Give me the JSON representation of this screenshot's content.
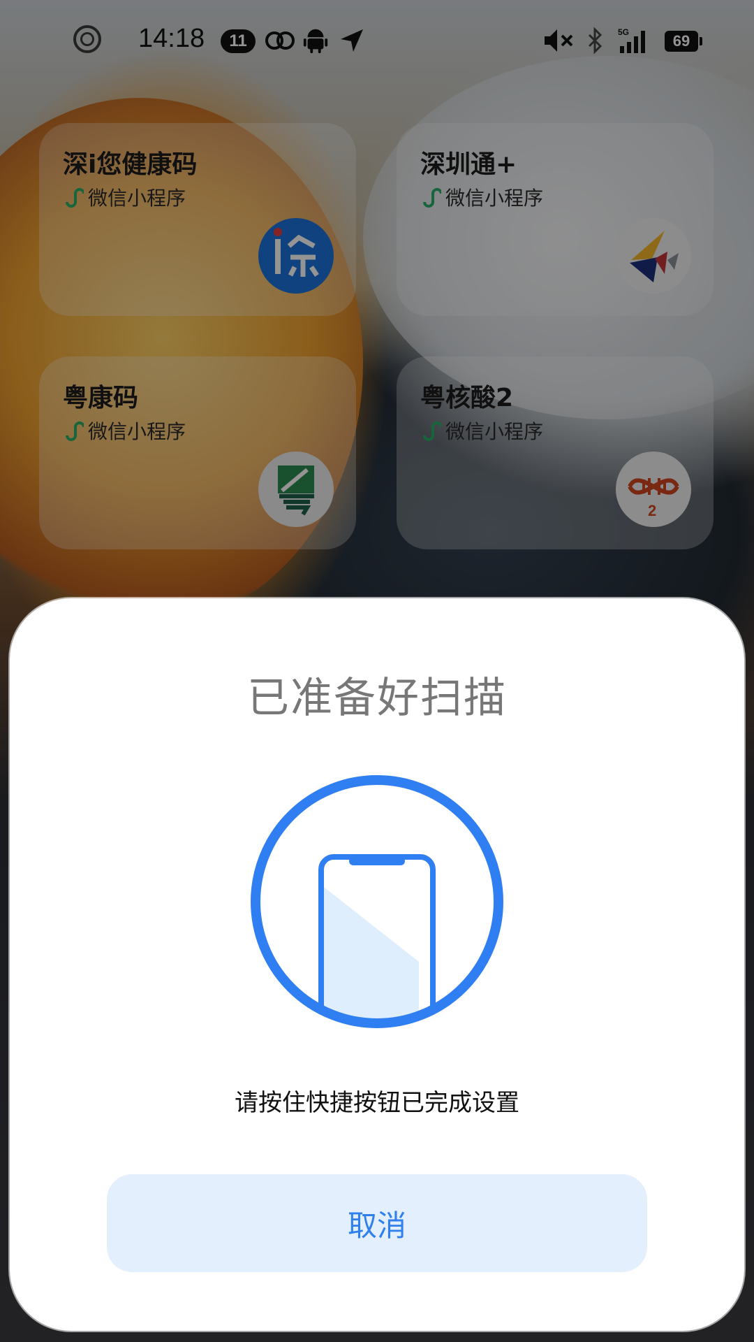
{
  "status_bar": {
    "time": "14:18",
    "notification_count": "11",
    "battery": "69",
    "network": "5G",
    "icons": [
      "circle-status-icon",
      "infinity-icon",
      "android-icon",
      "location-arrow-icon",
      "mute-icon",
      "bluetooth-icon",
      "signal-icon",
      "battery-icon"
    ]
  },
  "widgets": [
    {
      "title": "深i您健康码",
      "subtitle": "微信小程序",
      "icon": "shen-i-health-code-app-icon",
      "icon_color": "#1a73d9"
    },
    {
      "title": "深圳通+",
      "subtitle": "微信小程序",
      "icon": "shenzhentong-app-icon",
      "icon_color": "#f2f2f2"
    },
    {
      "title": "粤康码",
      "subtitle": "微信小程序",
      "icon": "yue-health-code-app-icon",
      "icon_color": "#eeeeee"
    },
    {
      "title": "粤核酸2",
      "subtitle": "微信小程序",
      "icon": "yue-nucleic-acid-app-icon",
      "icon_color": "#f2f2f2"
    }
  ],
  "sheet": {
    "title": "已准备好扫描",
    "hint": "请按住快捷按钮已完成设置",
    "cancel_label": "取消",
    "illustration": "phone-scan-icon"
  },
  "colors": {
    "accent": "#2f80ed",
    "cancel_bg": "#e3effd",
    "miniprogram_green": "#2aae67"
  }
}
